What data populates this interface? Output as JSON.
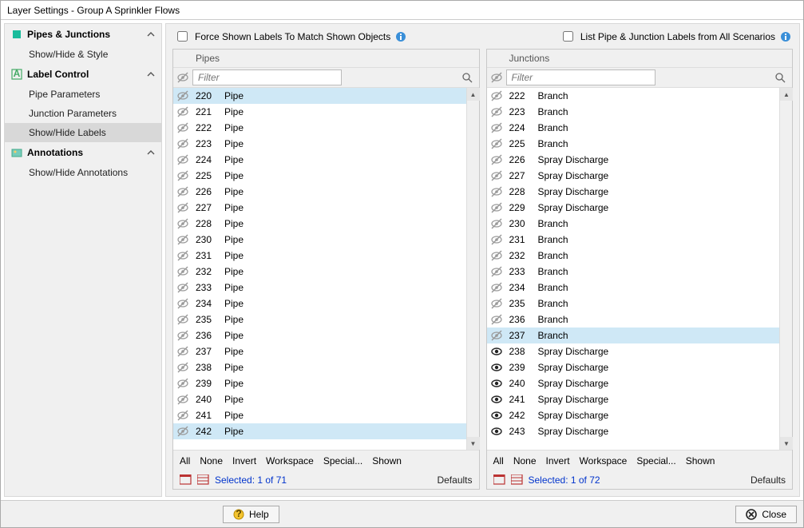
{
  "title": "Layer Settings - Group A Sprinkler Flows",
  "sidebar": {
    "sections": [
      {
        "icon": "pipes",
        "label": "Pipes & Junctions",
        "items": [
          "Show/Hide & Style"
        ]
      },
      {
        "icon": "label",
        "label": "Label Control",
        "items": [
          "Pipe Parameters",
          "Junction Parameters",
          "Show/Hide Labels"
        ],
        "selected": 2
      },
      {
        "icon": "anno",
        "label": "Annotations",
        "items": [
          "Show/Hide Annotations"
        ]
      }
    ]
  },
  "topbar": {
    "force_label": "Force Shown Labels To Match Shown Objects",
    "list_label": "List Pipe & Junction Labels from All Scenarios"
  },
  "panels": {
    "pipes": {
      "title": "Pipes",
      "filter_placeholder": "Filter",
      "rows": [
        {
          "id": "220",
          "name": "Pipe",
          "hidden": true,
          "selected": true
        },
        {
          "id": "221",
          "name": "Pipe",
          "hidden": true
        },
        {
          "id": "222",
          "name": "Pipe",
          "hidden": true
        },
        {
          "id": "223",
          "name": "Pipe",
          "hidden": true
        },
        {
          "id": "224",
          "name": "Pipe",
          "hidden": true
        },
        {
          "id": "225",
          "name": "Pipe",
          "hidden": true
        },
        {
          "id": "226",
          "name": "Pipe",
          "hidden": true
        },
        {
          "id": "227",
          "name": "Pipe",
          "hidden": true
        },
        {
          "id": "228",
          "name": "Pipe",
          "hidden": true
        },
        {
          "id": "230",
          "name": "Pipe",
          "hidden": true
        },
        {
          "id": "231",
          "name": "Pipe",
          "hidden": true
        },
        {
          "id": "232",
          "name": "Pipe",
          "hidden": true
        },
        {
          "id": "233",
          "name": "Pipe",
          "hidden": true
        },
        {
          "id": "234",
          "name": "Pipe",
          "hidden": true
        },
        {
          "id": "235",
          "name": "Pipe",
          "hidden": true
        },
        {
          "id": "236",
          "name": "Pipe",
          "hidden": true
        },
        {
          "id": "237",
          "name": "Pipe",
          "hidden": true
        },
        {
          "id": "238",
          "name": "Pipe",
          "hidden": true
        },
        {
          "id": "239",
          "name": "Pipe",
          "hidden": true
        },
        {
          "id": "240",
          "name": "Pipe",
          "hidden": true
        },
        {
          "id": "241",
          "name": "Pipe",
          "hidden": true
        },
        {
          "id": "242",
          "name": "Pipe",
          "hidden": true,
          "selected": true
        }
      ],
      "selected": "Selected: 1 of 71"
    },
    "junctions": {
      "title": "Junctions",
      "filter_placeholder": "Filter",
      "rows": [
        {
          "id": "222",
          "name": "Branch",
          "hidden": true
        },
        {
          "id": "223",
          "name": "Branch",
          "hidden": true
        },
        {
          "id": "224",
          "name": "Branch",
          "hidden": true
        },
        {
          "id": "225",
          "name": "Branch",
          "hidden": true
        },
        {
          "id": "226",
          "name": "Spray Discharge",
          "hidden": true
        },
        {
          "id": "227",
          "name": "Spray Discharge",
          "hidden": true
        },
        {
          "id": "228",
          "name": "Spray Discharge",
          "hidden": true
        },
        {
          "id": "229",
          "name": "Spray Discharge",
          "hidden": true
        },
        {
          "id": "230",
          "name": "Branch",
          "hidden": true
        },
        {
          "id": "231",
          "name": "Branch",
          "hidden": true
        },
        {
          "id": "232",
          "name": "Branch",
          "hidden": true
        },
        {
          "id": "233",
          "name": "Branch",
          "hidden": true
        },
        {
          "id": "234",
          "name": "Branch",
          "hidden": true
        },
        {
          "id": "235",
          "name": "Branch",
          "hidden": true
        },
        {
          "id": "236",
          "name": "Branch",
          "hidden": true
        },
        {
          "id": "237",
          "name": "Branch",
          "hidden": true,
          "selected": true
        },
        {
          "id": "238",
          "name": "Spray Discharge",
          "hidden": false
        },
        {
          "id": "239",
          "name": "Spray Discharge",
          "hidden": false
        },
        {
          "id": "240",
          "name": "Spray Discharge",
          "hidden": false
        },
        {
          "id": "241",
          "name": "Spray Discharge",
          "hidden": false
        },
        {
          "id": "242",
          "name": "Spray Discharge",
          "hidden": false
        },
        {
          "id": "243",
          "name": "Spray Discharge",
          "hidden": false
        }
      ],
      "selected": "Selected: 1 of 72"
    },
    "sel_actions": [
      "All",
      "None",
      "Invert",
      "Workspace",
      "Special...",
      "Shown"
    ],
    "defaults": "Defaults"
  },
  "buttons": {
    "help": "Help",
    "close": "Close"
  }
}
